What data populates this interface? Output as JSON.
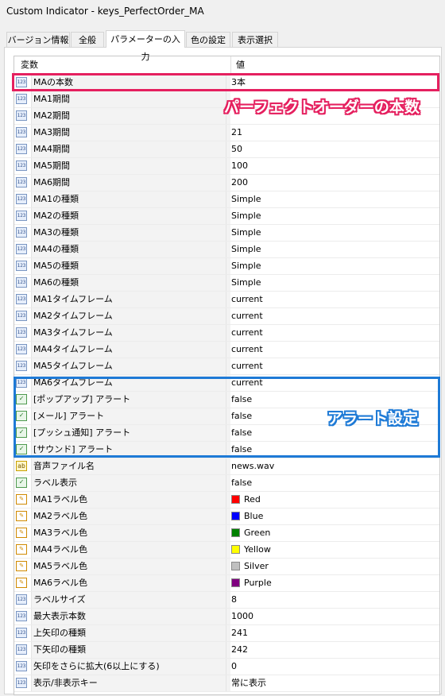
{
  "window": {
    "title": "Custom Indicator - keys_PerfectOrder_MA"
  },
  "tabs": [
    {
      "label": "バージョン情報"
    },
    {
      "label": "全般"
    },
    {
      "label": "パラメーターの入力"
    },
    {
      "label": "色の設定"
    },
    {
      "label": "表示選択"
    }
  ],
  "active_tab": "パラメーターの入力",
  "grid": {
    "header": {
      "col1": "変数",
      "col2": "値"
    },
    "rows": [
      {
        "icon": "int",
        "icon_label": "123",
        "name": "MAの本数",
        "value": "3本"
      },
      {
        "icon": "int",
        "icon_label": "123",
        "name": "MA1期間",
        "value": ""
      },
      {
        "icon": "int",
        "icon_label": "123",
        "name": "MA2期間",
        "value": ""
      },
      {
        "icon": "int",
        "icon_label": "123",
        "name": "MA3期間",
        "value": "21"
      },
      {
        "icon": "int",
        "icon_label": "123",
        "name": "MA4期間",
        "value": "50"
      },
      {
        "icon": "int",
        "icon_label": "123",
        "name": "MA5期間",
        "value": "100"
      },
      {
        "icon": "int",
        "icon_label": "123",
        "name": "MA6期間",
        "value": "200"
      },
      {
        "icon": "int",
        "icon_label": "123",
        "name": "MA1の種類",
        "value": "Simple"
      },
      {
        "icon": "int",
        "icon_label": "123",
        "name": "MA2の種類",
        "value": "Simple"
      },
      {
        "icon": "int",
        "icon_label": "123",
        "name": "MA3の種類",
        "value": "Simple"
      },
      {
        "icon": "int",
        "icon_label": "123",
        "name": "MA4の種類",
        "value": "Simple"
      },
      {
        "icon": "int",
        "icon_label": "123",
        "name": "MA5の種類",
        "value": "Simple"
      },
      {
        "icon": "int",
        "icon_label": "123",
        "name": "MA6の種類",
        "value": "Simple"
      },
      {
        "icon": "int",
        "icon_label": "123",
        "name": "MA1タイムフレーム",
        "value": "current"
      },
      {
        "icon": "int",
        "icon_label": "123",
        "name": "MA2タイムフレーム",
        "value": "current"
      },
      {
        "icon": "int",
        "icon_label": "123",
        "name": "MA3タイムフレーム",
        "value": "current"
      },
      {
        "icon": "int",
        "icon_label": "123",
        "name": "MA4タイムフレーム",
        "value": "current"
      },
      {
        "icon": "int",
        "icon_label": "123",
        "name": "MA5タイムフレーム",
        "value": "current"
      },
      {
        "icon": "int",
        "icon_label": "123",
        "name": "MA6タイムフレーム",
        "value": "current"
      },
      {
        "icon": "bool",
        "icon_label": "✓",
        "name": "[ポップアップ] アラート",
        "value": "false"
      },
      {
        "icon": "bool",
        "icon_label": "✓",
        "name": "[メール] アラート",
        "value": "false"
      },
      {
        "icon": "bool",
        "icon_label": "✓",
        "name": "[プッシュ通知] アラート",
        "value": "false"
      },
      {
        "icon": "bool",
        "icon_label": "✓",
        "name": "[サウンド] アラート",
        "value": "false"
      },
      {
        "icon": "str",
        "icon_label": "ab",
        "name": "音声ファイル名",
        "value": "news.wav"
      },
      {
        "icon": "bool",
        "icon_label": "✓",
        "name": "ラベル表示",
        "value": "false"
      },
      {
        "icon": "col",
        "icon_label": "✎",
        "name": "MA1ラベル色",
        "value": "Red",
        "color": "#ff0000"
      },
      {
        "icon": "col",
        "icon_label": "✎",
        "name": "MA2ラベル色",
        "value": "Blue",
        "color": "#0000ff"
      },
      {
        "icon": "col",
        "icon_label": "✎",
        "name": "MA3ラベル色",
        "value": "Green",
        "color": "#008000"
      },
      {
        "icon": "col",
        "icon_label": "✎",
        "name": "MA4ラベル色",
        "value": "Yellow",
        "color": "#ffff00"
      },
      {
        "icon": "col",
        "icon_label": "✎",
        "name": "MA5ラベル色",
        "value": "Silver",
        "color": "#c0c0c0"
      },
      {
        "icon": "col",
        "icon_label": "✎",
        "name": "MA6ラベル色",
        "value": "Purple",
        "color": "#800080"
      },
      {
        "icon": "int",
        "icon_label": "123",
        "name": "ラベルサイズ",
        "value": "8"
      },
      {
        "icon": "int",
        "icon_label": "123",
        "name": "最大表示本数",
        "value": "1000"
      },
      {
        "icon": "int",
        "icon_label": "123",
        "name": "上矢印の種類",
        "value": "241"
      },
      {
        "icon": "int",
        "icon_label": "123",
        "name": "下矢印の種類",
        "value": "242"
      },
      {
        "icon": "int",
        "icon_label": "123",
        "name": "矢印をさらに拡大(6以上にする)",
        "value": "0"
      },
      {
        "icon": "int",
        "icon_label": "123",
        "name": "表示/非表示キー",
        "value": "常に表示"
      }
    ]
  },
  "annotations": {
    "pink_text": "パーフェクトオーダーの本数",
    "blue_text": "アラート設定",
    "pink_color": "#e5205f",
    "blue_color": "#1e7ad6"
  }
}
